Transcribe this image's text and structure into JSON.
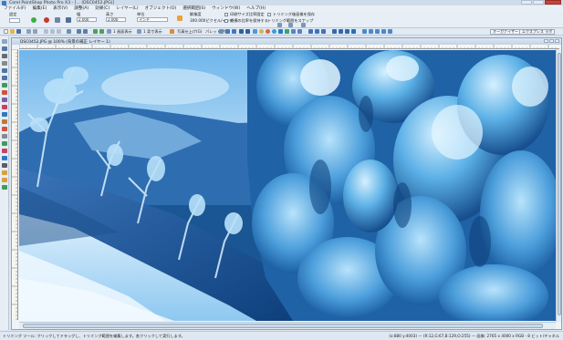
{
  "window": {
    "title": "Corel PaintShop Photo Pro X3 - [... (DSC0452.JPG)]"
  },
  "menu": [
    "ファイル(F)",
    "編集(E)",
    "表示(V)",
    "調整(A)",
    "効果(C)",
    "レイヤー(L)",
    "オブジェクト(O)",
    "選択範囲(S)",
    "ウィンドウ(W)",
    "ヘルプ(H)"
  ],
  "options": {
    "preset_label": "設定",
    "width_label": "幅",
    "width_value": "2.000",
    "height_label": "高さ",
    "height_value": "2.000",
    "unit_label": "単位",
    "unit_value": "インチ",
    "resolution_label": "解像度",
    "resolution_value": "300.000ピクセル/インチ",
    "chk1_label": "印刷サイズ比率固定",
    "chk2_label": "縦横の比率を保持する",
    "chk3_label": "トリミング後画像を保存",
    "align_label": "トリミング範囲をスナップ"
  },
  "toolbar": {
    "fit_label": "1 画面表示",
    "actual_label": "1 実寸表示",
    "photo_label": "写真仕上げ(G)",
    "palette_label": "パレット(P)",
    "organizer": "オーガナイザー",
    "express": "エクスプレス ラボ"
  },
  "document": {
    "tab_title": "DSC0452.JPG @ 100% (背景の補正 レイヤー 1)"
  },
  "status": {
    "left": "トリミング ツール: クリックしてドラッグし、トリミング範囲を編集します。各クリックして実行します。",
    "right": "(x:880 y:4003) — (R:12,G:67,B:129,O:255) — 画像: 2765 x 4000 x RGB - 8 ビット/チャネル"
  },
  "colors": {
    "accent": "#3a7bc4",
    "canvas_base": "#1d5a9a",
    "close": "#c8433a"
  }
}
